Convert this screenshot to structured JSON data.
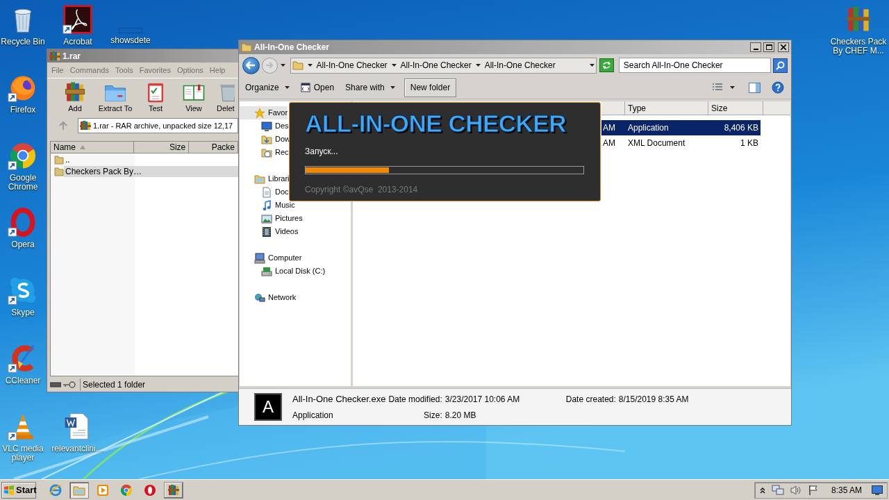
{
  "desktop_icons": [
    {
      "label": "Recycle Bin",
      "kind": "recycle",
      "shortcut": false
    },
    {
      "label": "Acrobat",
      "kind": "acrobat",
      "shortcut": true
    },
    {
      "label": "showsdete",
      "kind": "blank"
    },
    {
      "label": "Firefox",
      "kind": "firefox",
      "shortcut": true
    },
    {
      "label": "Google Chrome",
      "kind": "chrome",
      "shortcut": true
    },
    {
      "label": "Opera",
      "kind": "opera",
      "shortcut": true
    },
    {
      "label": "Skype",
      "kind": "skype",
      "shortcut": true
    },
    {
      "label": "CCleaner",
      "kind": "ccleaner",
      "shortcut": true
    },
    {
      "label": "VLC media player",
      "kind": "vlc",
      "shortcut": true
    },
    {
      "label": "relevantclini…",
      "kind": "word",
      "shortcut": false
    },
    {
      "label": "Checkers Pack By CHEF M...",
      "kind": "archive",
      "shortcut": false
    }
  ],
  "archive_window": {
    "title": "1.rar",
    "menu": [
      "File",
      "Commands",
      "Tools",
      "Favorites",
      "Options",
      "Help"
    ],
    "toolbar": [
      {
        "label": "Add",
        "kind": "add"
      },
      {
        "label": "Extract To",
        "kind": "extract"
      },
      {
        "label": "Test",
        "kind": "test"
      },
      {
        "label": "View",
        "kind": "view"
      },
      {
        "label": "Delet",
        "kind": "delete"
      }
    ],
    "address": "1.rar - RAR archive, unpacked size 12,17",
    "columns": [
      {
        "label": "Name",
        "sorted": true
      },
      {
        "label": "Size",
        "sorted": false
      },
      {
        "label": "Packe",
        "sorted": false
      }
    ],
    "rows": [
      {
        "name": "..",
        "selected": false
      },
      {
        "name": "Checkers Pack By…",
        "selected": true
      }
    ],
    "status": "Selected 1 folder"
  },
  "explorer_window": {
    "title": "All-In-One Checker",
    "breadcrumbs": [
      "All-In-One Checker",
      "All-In-One Checker",
      "All-In-One Checker"
    ],
    "search": {
      "placeholder": "Search All-In-One Checker"
    },
    "toolbar": [
      {
        "label": "Organize",
        "kind": "menu"
      },
      {
        "label": "Open",
        "kind": "open"
      },
      {
        "label": "Share with",
        "kind": "menu"
      },
      {
        "label": "New folder",
        "kind": "button"
      }
    ],
    "nav": [
      {
        "label": "Favor",
        "kind": "star",
        "selected": true,
        "children": [
          {
            "label": "Des",
            "kind": "desktop",
            "selected": false
          },
          {
            "label": "Dow",
            "kind": "downloads",
            "selected": false
          },
          {
            "label": "Rec",
            "kind": "recent",
            "selected": false
          }
        ]
      },
      {
        "label": "Librari",
        "kind": "library",
        "selected": false,
        "children": [
          {
            "label": "Doc",
            "kind": "documents",
            "selected": false
          },
          {
            "label": "Music",
            "kind": "music",
            "selected": false
          },
          {
            "label": "Pictures",
            "kind": "pictures",
            "selected": false
          },
          {
            "label": "Videos",
            "kind": "videos",
            "selected": false
          }
        ]
      },
      {
        "label": "Computer",
        "kind": "computer",
        "selected": false,
        "children": [
          {
            "label": "Local Disk (C:)",
            "kind": "disk",
            "selected": false
          }
        ]
      },
      {
        "label": "Network",
        "kind": "network",
        "selected": false
      }
    ],
    "columns": [
      "Type",
      "Size"
    ],
    "rows": [
      {
        "column_2": "AM",
        "type": "Application",
        "size": "8,406 KB",
        "selected": true
      },
      {
        "column_2": "AM",
        "type": "XML Document",
        "size": "1 KB",
        "selected": false
      }
    ],
    "details": {
      "thumbnail": "A",
      "name": "All-In-One Checker.exe",
      "type": "Application",
      "fields": [
        {
          "label": "Date modified:",
          "value": "3/23/2017 10:06 AM"
        },
        {
          "label": "Date created:",
          "value": "8/15/2019 8:35 AM"
        },
        {
          "label": "Size:",
          "value": "8.20 MB"
        }
      ]
    }
  },
  "splash": {
    "title": "ALL-IN-ONE CHECKER",
    "status": "Запуск...",
    "progress": {
      "level": 0.3
    },
    "copyright": "Copyright ©avQse  2013-2014"
  },
  "taskbar": {
    "start": "Start",
    "apps": [
      {
        "kind": "ie",
        "active": false,
        "open": false
      },
      {
        "kind": "explorer",
        "active": true,
        "open": true
      },
      {
        "kind": "media",
        "active": false,
        "open": false
      },
      {
        "kind": "chrome",
        "active": false,
        "open": false
      },
      {
        "kind": "opera",
        "active": false,
        "open": false
      },
      {
        "kind": "winrar",
        "active": false,
        "open": true
      }
    ],
    "clock": "8:35 AM"
  }
}
